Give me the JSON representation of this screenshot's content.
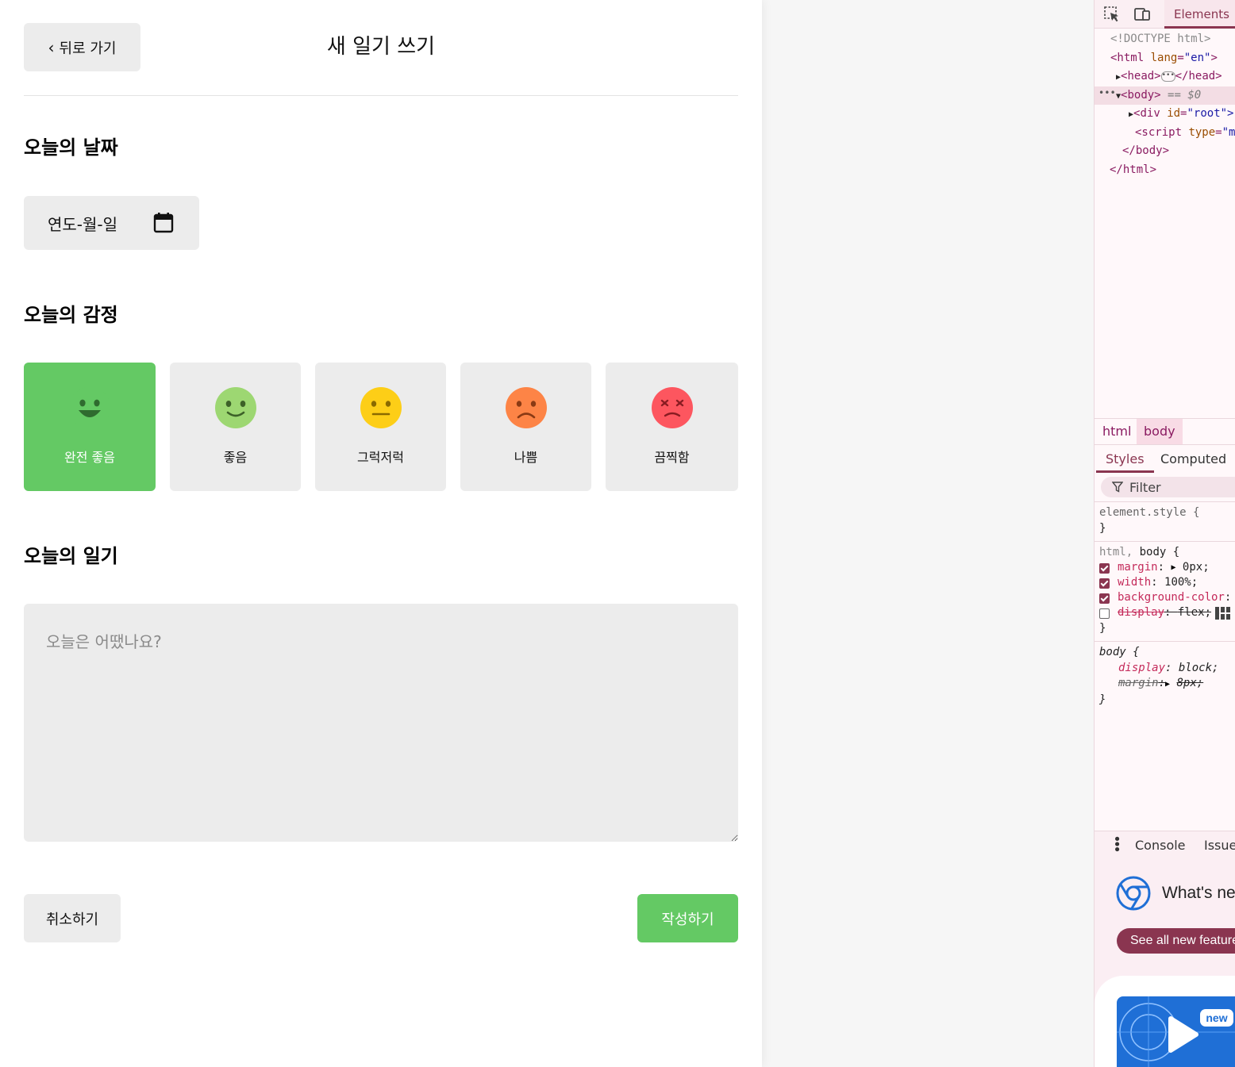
{
  "app": {
    "back_label": "뒤로 가기",
    "page_title": "새 일기 쓰기",
    "date_section_title": "오늘의 날짜",
    "date_placeholder": "연도-월-일",
    "emotion_section_title": "오늘의 감정",
    "emotions": [
      {
        "label": "완전 좋음",
        "color": "#64c964",
        "selected": true
      },
      {
        "label": "좋음",
        "color": "#9dd772",
        "selected": false
      },
      {
        "label": "그럭저럭",
        "color": "#fdce17",
        "selected": false
      },
      {
        "label": "나쁨",
        "color": "#fd8446",
        "selected": false
      },
      {
        "label": "끔찍함",
        "color": "#fd565f",
        "selected": false
      }
    ],
    "diary_section_title": "오늘의 일기",
    "diary_placeholder": "오늘은 어땠나요?",
    "cancel_label": "취소하기",
    "submit_label": "작성하기",
    "accent_color": "#64c964",
    "neutral_color": "#ececec"
  },
  "devtools": {
    "elements_tab": "Elements",
    "dom": {
      "doctype": "<!DOCTYPE html>",
      "html_open_tag": "<html",
      "html_lang_attr": "lang",
      "html_lang_value": "\"en\"",
      "head_open": "<head>",
      "head_close": "</head>",
      "body_open": "<body>",
      "body_eq": "== $0",
      "div_open": "<div",
      "div_id_attr": "id",
      "div_id_value": "\"root\">",
      "script_open": "<script",
      "script_type_attr": "type",
      "script_type_value": "\"mo",
      "body_close": "</body>",
      "html_close": "</html>"
    },
    "breadcrumb": [
      "html",
      "body"
    ],
    "subtabs": [
      "Styles",
      "Computed"
    ],
    "filter_placeholder": "Filter",
    "styles": {
      "element_style_selector": "element.style {",
      "close_brace": "}",
      "rule2_selector_html": "html,",
      "rule2_selector_body": "body {",
      "rule2_props": [
        {
          "name": "margin",
          "value": "0px;",
          "checked": true,
          "arrow": true
        },
        {
          "name": "width",
          "value": "100%;",
          "checked": true
        },
        {
          "name": "background-color",
          "value": "",
          "checked": true
        },
        {
          "name": "display",
          "value": "flex;",
          "checked": false,
          "struck": true
        }
      ],
      "rule3_selector": "body {",
      "rule3_props": [
        {
          "name": "display",
          "value": "block;"
        },
        {
          "name": "margin",
          "value": "8px;",
          "struck": true
        }
      ]
    },
    "drawer_tabs": [
      "Console",
      "Issues"
    ],
    "whats_new_title": "What's new",
    "whats_new_button": "See all new features",
    "thumb_badge": "new",
    "accent_color": "#8a3550"
  }
}
